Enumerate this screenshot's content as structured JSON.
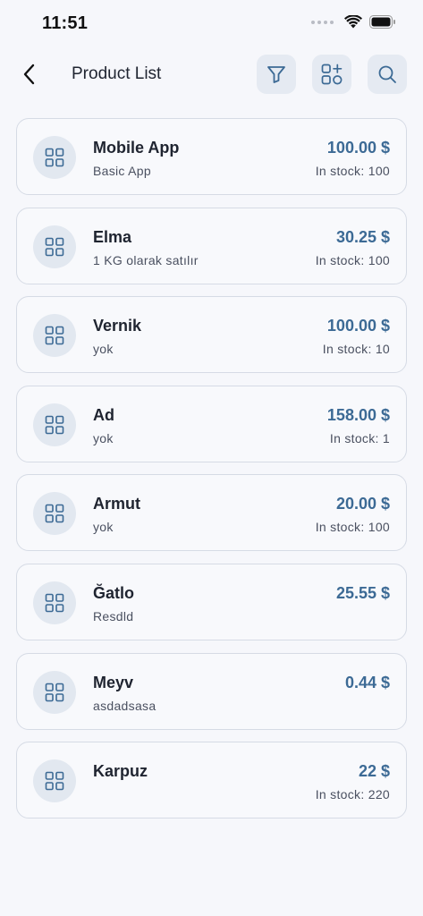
{
  "status_bar": {
    "time": "11:51"
  },
  "header": {
    "title": "Product List"
  },
  "products": [
    {
      "name": "Mobile App",
      "description": "Basic App",
      "price": "100.00 $",
      "stock": "In stock: 100"
    },
    {
      "name": "Elma",
      "description": "1 KG olarak satılır",
      "price": "30.25 $",
      "stock": "In stock: 100"
    },
    {
      "name": "Vernik",
      "description": "yok",
      "price": "100.00 $",
      "stock": "In stock: 10"
    },
    {
      "name": "Ad",
      "description": "yok",
      "price": "158.00 $",
      "stock": "In stock: 1"
    },
    {
      "name": "Armut",
      "description": "yok",
      "price": "20.00 $",
      "stock": "In stock: 100"
    },
    {
      "name": "Ğatlo",
      "description": "Resdld",
      "price": "25.55 $",
      "stock": ""
    },
    {
      "name": "Meyv",
      "description": "asdadsasa",
      "price": "0.44 $",
      "stock": ""
    },
    {
      "name": "Karpuz",
      "description": "",
      "price": "22 $",
      "stock": "In stock: 220"
    }
  ],
  "icons": {
    "back": "chevron-left-icon",
    "filter": "filter-icon",
    "add": "add-category-icon",
    "search": "search-icon",
    "product_thumb": "grid-icon"
  },
  "colors": {
    "accent": "#3c6a95",
    "button_bg": "#e5eaf2",
    "background": "#f6f7fb",
    "card_border": "#d6dbe5"
  }
}
